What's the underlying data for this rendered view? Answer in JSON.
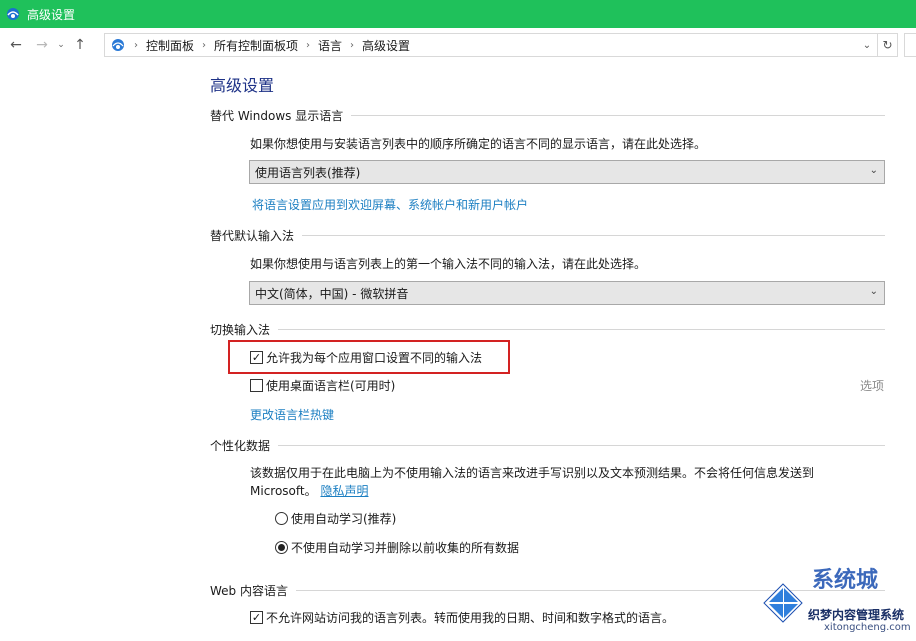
{
  "window": {
    "title": "高级设置"
  },
  "breadcrumb": [
    "控制面板",
    "所有控制面板项",
    "语言",
    "高级设置"
  ],
  "page": {
    "title": "高级设置"
  },
  "sections": {
    "display_language": {
      "header": "替代 Windows 显示语言",
      "description": "如果你想使用与安装语言列表中的顺序所确定的语言不同的显示语言，请在此处选择。",
      "select_value": "使用语言列表(推荐)",
      "link": "将语言设置应用到欢迎屏幕、系统帐户和新用户帐户"
    },
    "input_method": {
      "header": "替代默认输入法",
      "description": "如果你想使用与语言列表上的第一个输入法不同的输入法，请在此处选择。",
      "select_value": "中文(简体，中国) - 微软拼音"
    },
    "switch_input": {
      "header": "切换输入法",
      "per_app_checkbox": {
        "label": "允许我为每个应用窗口设置不同的输入法",
        "checked": true
      },
      "desktop_bar_checkbox": {
        "label": "使用桌面语言栏(可用时)",
        "checked": false
      },
      "options_label": "选项",
      "hotkeys_link": "更改语言栏热键"
    },
    "personalization": {
      "header": "个性化数据",
      "description_line1": "该数据仅用于在此电脑上为不使用输入法的语言来改进手写识别以及文本预测结果。不会将任何信息发送到",
      "description_line2_prefix": "Microsoft。",
      "privacy_link": "隐私声明",
      "radio_auto": {
        "label": "使用自动学习(推荐)",
        "selected": false
      },
      "radio_no_auto": {
        "label": "不使用自动学习并删除以前收集的所有数据",
        "selected": true
      }
    },
    "web_content": {
      "header": "Web 内容语言",
      "checkbox": {
        "label": "不允许网站访问我的语言列表。转而使用我的日期、时间和数字格式的语言。",
        "checked": true
      }
    }
  },
  "watermark": {
    "title": "系统城",
    "subtitle": "织梦内容管理系统",
    "url": "xitongcheng.com"
  },
  "colors": {
    "titlebar": "#1fc15b",
    "page_title": "#1e3287",
    "link": "#1c7fc2",
    "highlight_border": "#d32222"
  }
}
